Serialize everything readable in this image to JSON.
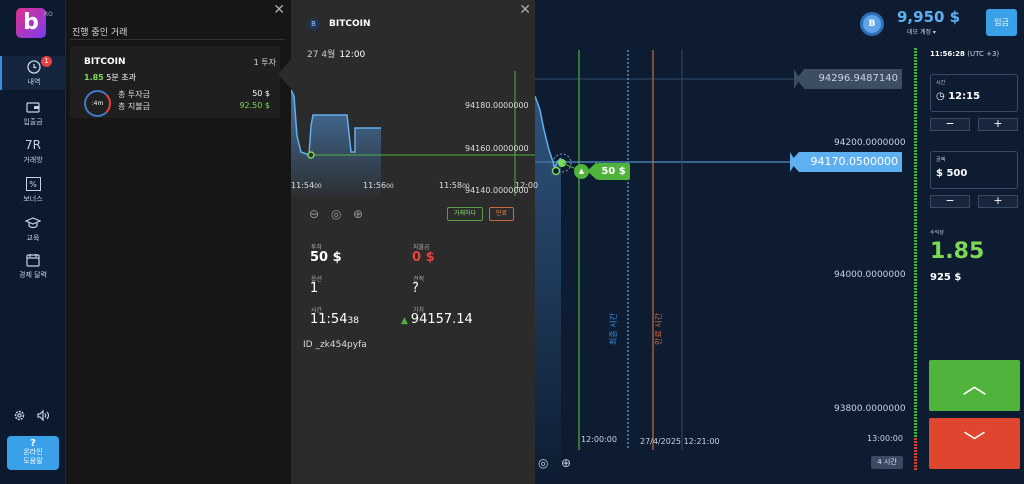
{
  "brand": {
    "logo_letter": "b",
    "logo_sub": "RO"
  },
  "sidebar": {
    "items": [
      {
        "label": "내역",
        "icon": "history-clock-icon",
        "badge": "1"
      },
      {
        "label": "입출금",
        "icon": "wallet-icon"
      },
      {
        "label": "거래방",
        "icon": "trading-room-icon",
        "glyph": "7R"
      },
      {
        "label": "보너스",
        "icon": "percent-icon",
        "glyph": "%"
      },
      {
        "label": "교육",
        "icon": "graduation-cap-icon"
      },
      {
        "label": "경제 달력",
        "icon": "calendar-icon"
      }
    ],
    "help_icon": "?",
    "help_label_1": "온라인",
    "help_label_2": "도움말"
  },
  "trades_panel": {
    "title": "진행 중인 거래",
    "trade": {
      "asset": "BITCOIN",
      "count": "1 투자",
      "payout_multiplier": "1.85",
      "payout_text": "5분 초과",
      "timer": ":4m",
      "total_invest_label": "총 투자금",
      "total_invest_value": "50 $",
      "total_payout_label": "총 지불금",
      "total_payout_value": "92.50 $"
    }
  },
  "detail": {
    "asset": "BITCOIN",
    "coin_glyph": "B",
    "date": "27 4월",
    "time": "12:00",
    "price_labels": [
      "94180.0000000",
      "94160.0000000",
      "94140.0000000"
    ],
    "time_labels": [
      "11:54",
      "11:56",
      "11:58",
      "12:00"
    ],
    "time_suffix": "00",
    "trade_button": "거래하다",
    "close_button": "만료",
    "invest_label": "투자",
    "invest_value": "50 $",
    "payout_label": "지불금",
    "payout_value": "0 $",
    "option_label": "옵션",
    "option_value": "1",
    "forecast_label": "견적",
    "forecast_value": "?",
    "time_label": "시간",
    "time_value": "11:54",
    "time_value_sec": "38",
    "price_label": "가치",
    "price_value": "94157.14",
    "id": "ID _zk454pyfa"
  },
  "main_chart": {
    "price_top": "94296.9487140",
    "price_current": "94170.0500000",
    "axis": [
      "94200.0000000",
      "94000.0000000",
      "93800.0000000"
    ],
    "bet_amount": "50 $",
    "label_last_time": "최종 시간",
    "label_expire_time": "만료 시간",
    "time_ticks": [
      "12:00:00",
      "27/4/2025 12:21:00",
      "13:00:00"
    ],
    "timeframe": "4 시간"
  },
  "header": {
    "coin_glyph": "B",
    "balance": "9,950 $",
    "account": "데모 계정 ▾",
    "deposit": "입금"
  },
  "trade_panel": {
    "clock": "11:56:28",
    "timezone": "(UTC +3)",
    "time_label": "시간",
    "time_value": "12:15",
    "amount_label": "금액",
    "amount_value": "$ 500",
    "minus": "−",
    "plus": "+",
    "profit_label": "수익성",
    "profit_value": "1.85",
    "profit_amount": "925 $"
  },
  "colors": {
    "up": "#4fb33c",
    "down": "#e04530",
    "accent": "#3aa0e8",
    "line": "#5fb0f0"
  }
}
